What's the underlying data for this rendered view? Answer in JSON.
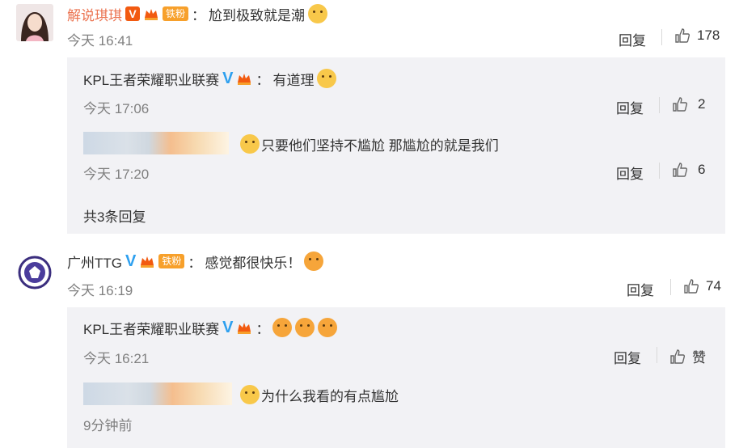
{
  "comments": [
    {
      "username": "解说琪琪",
      "colon": "：",
      "fan_badge": "铁粉",
      "text": "尬到极致就是潮",
      "time": "今天 16:41",
      "reply_label": "回复",
      "likes": "178",
      "replies": [
        {
          "username": "KPL王者荣耀职业联赛",
          "text": "有道理",
          "time": "今天 17:06",
          "reply_label": "回复",
          "likes": "2"
        },
        {
          "username": "",
          "text": "只要他们坚持不尴尬 那尴尬的就是我们",
          "time": "今天 17:20",
          "reply_label": "回复",
          "likes": "6"
        }
      ],
      "more_replies": "共3条回复"
    },
    {
      "username": "广州TTG",
      "colon": "：",
      "fan_badge": "铁粉",
      "text": "感觉都很快乐！",
      "time": "今天 16:19",
      "reply_label": "回复",
      "likes": "74",
      "replies": [
        {
          "username": "KPL王者荣耀职业联赛",
          "text": "",
          "time": "今天 16:21",
          "reply_label": "回复",
          "likes": "赞"
        },
        {
          "username": "",
          "text": "为什么我看的有点尴尬",
          "time": "9分钟前"
        }
      ]
    }
  ],
  "icons": {
    "verified_v": "verified-v-icon",
    "crown": "crown-badge-icon",
    "thumb": "thumbs-up-icon",
    "emoji_dog": "doge-emoji-icon",
    "emoji_laugh": "laugh-emoji-icon"
  },
  "colors": {
    "username": "#eb7350",
    "link_blue": "#2b6fb3",
    "reply_bg": "#f2f2f5",
    "time_gray": "#808080"
  }
}
